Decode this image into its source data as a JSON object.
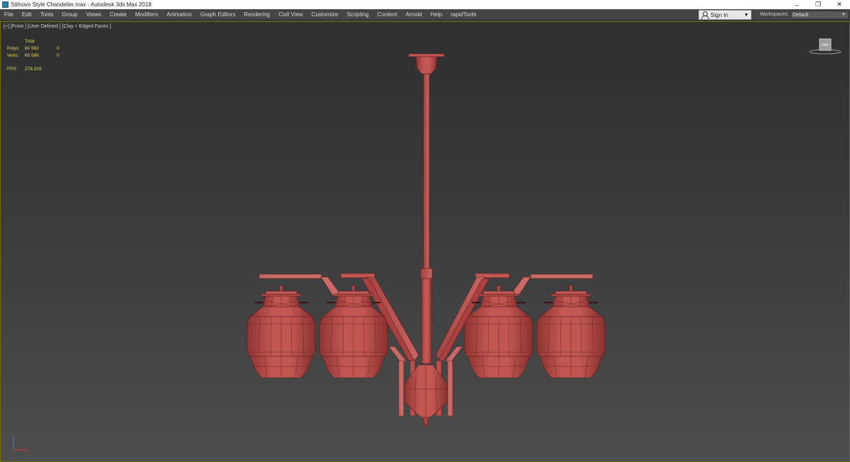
{
  "window": {
    "title": "Stilnovo Style Chandelier.max - Autodesk 3ds Max 2018",
    "minimize": "–",
    "restore": "❐",
    "close": "✕"
  },
  "menu": {
    "items": [
      "File",
      "Edit",
      "Tools",
      "Group",
      "Views",
      "Create",
      "Modifiers",
      "Animation",
      "Graph Editors",
      "Rendering",
      "Civil View",
      "Customize",
      "Scripting",
      "Content",
      "Arnold",
      "Help",
      "rapidTools"
    ],
    "sign_in": "Sign In",
    "workspaces_label": "Workspaces:",
    "workspaces_value": "Default"
  },
  "viewport": {
    "label": "[+] [Front ] [User Defined ] [Clay + Edged Faces ]",
    "stats": {
      "header": "Total",
      "polys_label": "Polys:",
      "polys_total": "60 582",
      "polys_sel": "0",
      "verts_label": "Verts:",
      "verts_total": "60 586",
      "verts_sel": "0",
      "fps_label": "FPS:",
      "fps_value": "278,319"
    },
    "model_color": "#b94a48"
  }
}
